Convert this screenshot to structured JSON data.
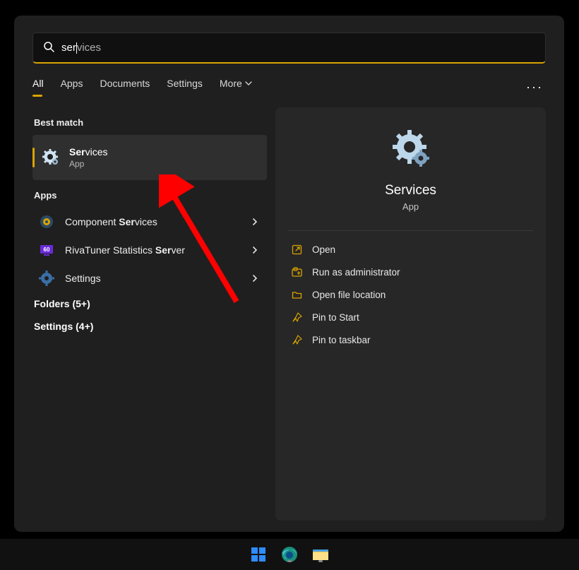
{
  "search": {
    "typed": "ser",
    "completion": "vices"
  },
  "tabs": {
    "all": "All",
    "apps": "Apps",
    "documents": "Documents",
    "settings": "Settings",
    "more": "More"
  },
  "sections": {
    "best_match": "Best match",
    "apps": "Apps"
  },
  "best_match": {
    "title_bold": "Ser",
    "title_rest": "vices",
    "subtitle": "App"
  },
  "apps_list": [
    {
      "pre": "Component ",
      "bold": "Ser",
      "post": "vices"
    },
    {
      "pre": "RivaTuner Statistics ",
      "bold": "Ser",
      "post": "ver"
    },
    {
      "pre": "Settings",
      "bold": "",
      "post": ""
    }
  ],
  "extras": {
    "folders": "Folders (5+)",
    "settings": "Settings (4+)"
  },
  "detail": {
    "title": "Services",
    "subtitle": "App",
    "actions": [
      "Open",
      "Run as administrator",
      "Open file location",
      "Pin to Start",
      "Pin to taskbar"
    ]
  }
}
